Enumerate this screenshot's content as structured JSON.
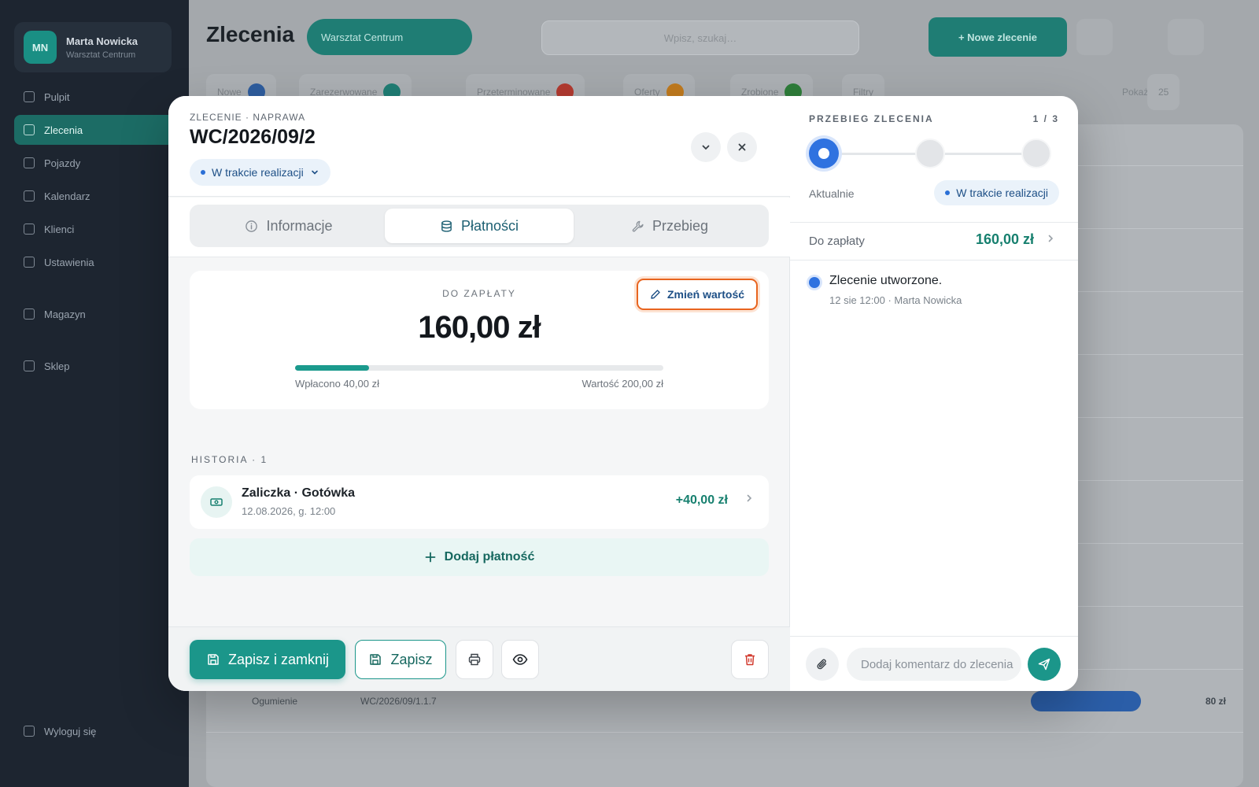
{
  "background": {
    "user": {
      "initials": "MN",
      "name": "Marta Nowicka",
      "role": "Warsztat Centrum"
    },
    "nav": [
      "Pulpit",
      "Zlecenia",
      "Pojazdy",
      "Kalendarz",
      "Klienci",
      "Ustawienia",
      "Magazyn",
      "Sklep"
    ],
    "nav_bottom": "Wyloguj się",
    "page_title": "Zlecenia",
    "location_pill": "Warsztat Centrum",
    "search_placeholder": "Wpisz, szukaj…",
    "new_order_button": "+ Nowe zlecenie",
    "filters": [
      "Nowe",
      "Zarezerwowane",
      "Przeterminowane",
      "Oferty",
      "Zrobione",
      "Filtry"
    ],
    "per_page_label": "Pokaż",
    "per_page_value": "25",
    "visible_row_type": "Ogumienie",
    "visible_row_number": "WC/2026/09/1.1.7",
    "visible_row_amount": "80 zł"
  },
  "modal": {
    "eyebrow": "ZLECENIE · NAPRAWA",
    "order_number": "WC/2026/09/2",
    "status": "W trakcie realizacji",
    "tabs": [
      {
        "label": "Informacje",
        "icon": "info-icon"
      },
      {
        "label": "Płatności",
        "icon": "database-icon"
      },
      {
        "label": "Przebieg",
        "icon": "wrench-icon"
      }
    ],
    "active_tab": 1,
    "payment": {
      "label": "DO ZAPŁATY",
      "amount": "160,00 zł",
      "paid_text": "Wpłacono 40,00 zł",
      "value_text": "Wartość 200,00 zł",
      "paid_fraction": 0.2,
      "change_button": "Zmień wartość"
    },
    "history": {
      "label": "HISTORIA · 1",
      "items": [
        {
          "title": "Zaliczka · Gotówka",
          "date": "12.08.2026, g. 12:00",
          "amount": "+40,00 zł",
          "icon": "cash-icon"
        }
      ]
    },
    "add_payment_button": "Dodaj płatność",
    "footer": {
      "save_close": "Zapisz i zamknij",
      "save": "Zapisz"
    }
  },
  "timeline_panel": {
    "title": "PRZEBIEG ZLECENIA",
    "step_counter": "1 / 3",
    "now_label": "Aktualnie",
    "status": "W trakcie realizacji",
    "due_label": "Do zapłaty",
    "due_amount": "160,00 zł",
    "events": [
      {
        "title": "Zlecenie utworzone.",
        "meta": "12 sie 12:00 · Marta Nowicka"
      }
    ],
    "comment_placeholder": "Dodaj komentarz do zlecenia"
  },
  "colors": {
    "accent": "#1b968a",
    "status_blue": "#2f72e0",
    "highlight": "#e8641f"
  }
}
